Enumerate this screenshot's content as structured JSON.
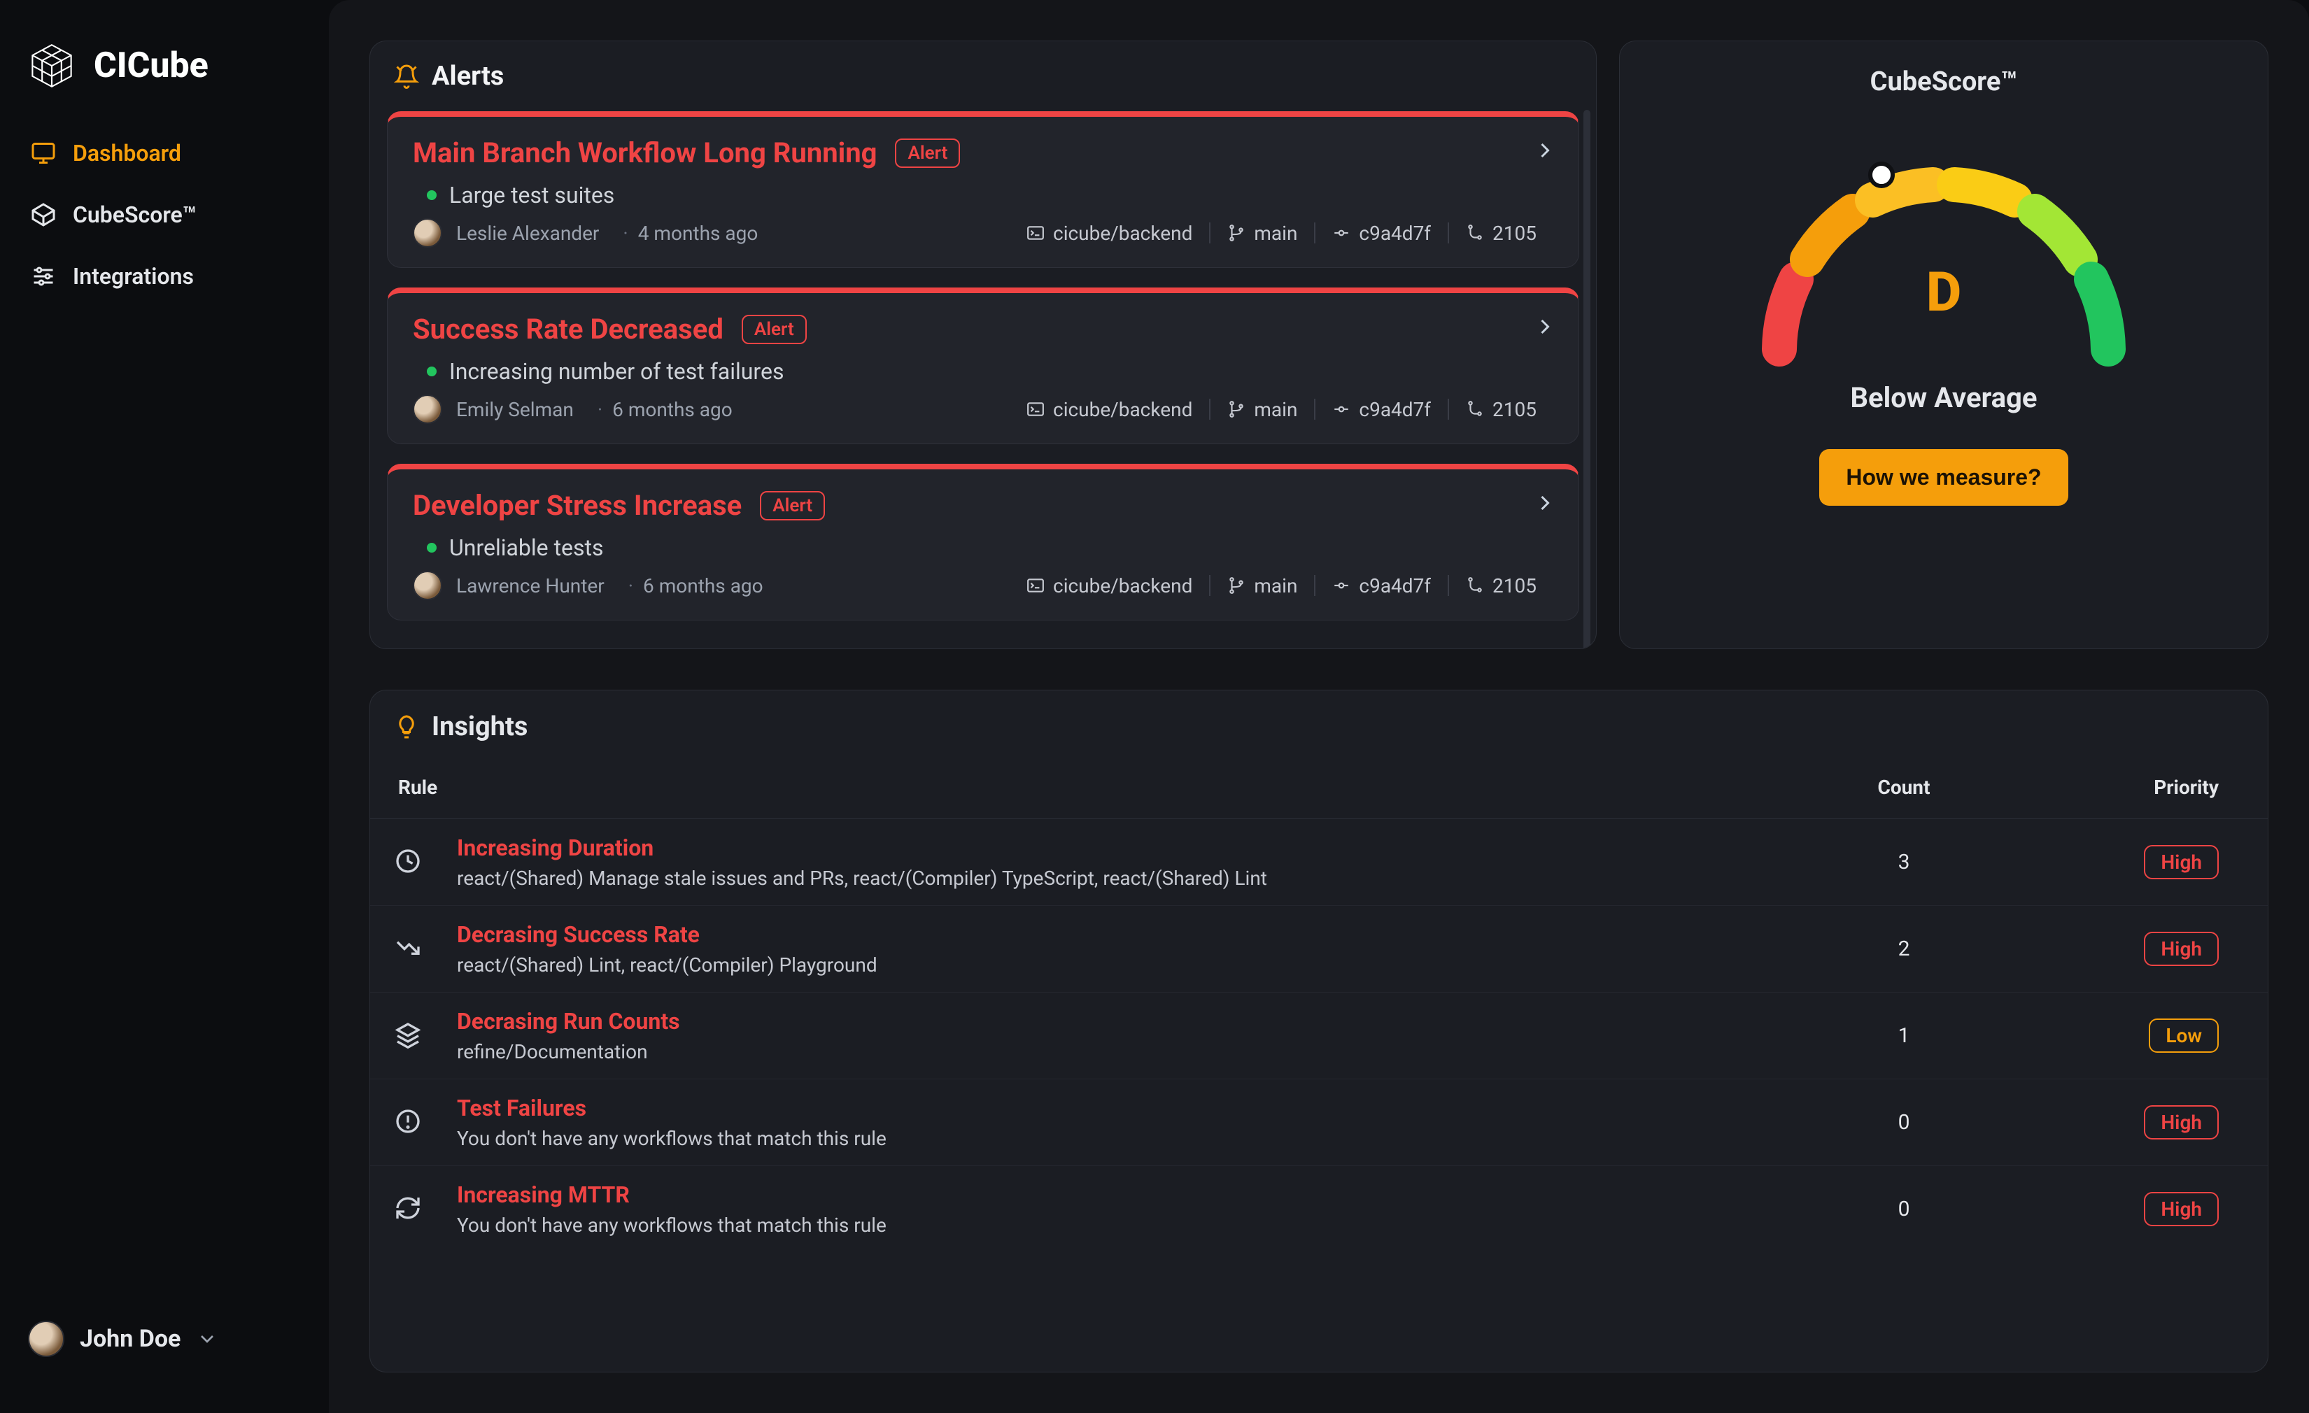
{
  "brand": {
    "name": "CICube"
  },
  "sidebar": {
    "items": [
      {
        "label": "Dashboard",
        "active": true
      },
      {
        "label": "CubeScore™",
        "active": false
      },
      {
        "label": "Integrations",
        "active": false
      }
    ],
    "user": {
      "name": "John Doe"
    }
  },
  "alerts": {
    "title": "Alerts",
    "items": [
      {
        "title": "Main Branch Workflow Long Running",
        "badge": "Alert",
        "subtitle": "Large test suites",
        "author": "Leslie Alexander",
        "time": "4 months ago",
        "repo": "cicube/backend",
        "branch": "main",
        "commit": "c9a4d7f",
        "run": "2105"
      },
      {
        "title": "Success Rate Decreased",
        "badge": "Alert",
        "subtitle": "Increasing number of test failures",
        "author": "Emily Selman",
        "time": "6 months ago",
        "repo": "cicube/backend",
        "branch": "main",
        "commit": "c9a4d7f",
        "run": "2105"
      },
      {
        "title": "Developer Stress Increase",
        "badge": "Alert",
        "subtitle": "Unreliable tests",
        "author": "Lawrence Hunter",
        "time": "6 months ago",
        "repo": "cicube/backend",
        "branch": "main",
        "commit": "c9a4d7f",
        "run": "2105"
      }
    ]
  },
  "cubescore": {
    "title": "CubeScore™",
    "grade": "D",
    "label": "Below Average",
    "button": "How we measure?",
    "segments": [
      {
        "color": "#ef4444"
      },
      {
        "color": "#f59e0b"
      },
      {
        "color": "#fbbf24"
      },
      {
        "color": "#facc15"
      },
      {
        "color": "#a3e635"
      },
      {
        "color": "#22c55e"
      }
    ]
  },
  "insights": {
    "title": "Insights",
    "columns": {
      "rule": "Rule",
      "count": "Count",
      "priority": "Priority"
    },
    "rows": [
      {
        "icon": "clock",
        "name": "Increasing Duration",
        "desc": "react/(Shared) Manage stale issues and PRs, react/(Compiler) TypeScript, react/(Shared) Lint",
        "count": "3",
        "priority": "High"
      },
      {
        "icon": "trend-down",
        "name": "Decrasing Success Rate",
        "desc": "react/(Shared) Lint, react/(Compiler) Playground",
        "count": "2",
        "priority": "High"
      },
      {
        "icon": "layers",
        "name": "Decrasing Run Counts",
        "desc": "refine/Documentation",
        "count": "1",
        "priority": "Low"
      },
      {
        "icon": "alert-circle",
        "name": "Test Failures",
        "desc": "You don't have any workflows that match this rule",
        "count": "0",
        "priority": "High"
      },
      {
        "icon": "refresh",
        "name": "Increasing MTTR",
        "desc": "You don't have any workflows that match this rule",
        "count": "0",
        "priority": "High"
      }
    ]
  }
}
